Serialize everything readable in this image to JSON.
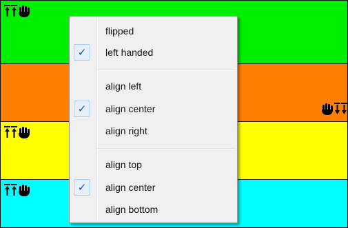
{
  "bands": {
    "colors": {
      "green": "#00ee00",
      "orange": "#ff7f00",
      "yellow": "#ffff00",
      "cyan": "#00ffff"
    }
  },
  "glyphs": {
    "top_left": [
      "up-arrow-icon",
      "up-arrow-icon",
      "hand-icon"
    ],
    "right": [
      "hand-icon",
      "down-arrow-icon",
      "down-arrow-icon"
    ]
  },
  "menu": {
    "items": [
      {
        "label": "flipped",
        "checked": false
      },
      {
        "label": "left handed",
        "checked": true
      },
      {
        "label": "align left",
        "checked": false
      },
      {
        "label": "align center",
        "checked": true
      },
      {
        "label": "align right",
        "checked": false
      },
      {
        "label": "align top",
        "checked": false
      },
      {
        "label": "align center",
        "checked": true
      },
      {
        "label": "align bottom",
        "checked": false
      }
    ],
    "check_glyph": "✓",
    "check_color": "#1a4fb0",
    "background": "#f0f0f0"
  }
}
